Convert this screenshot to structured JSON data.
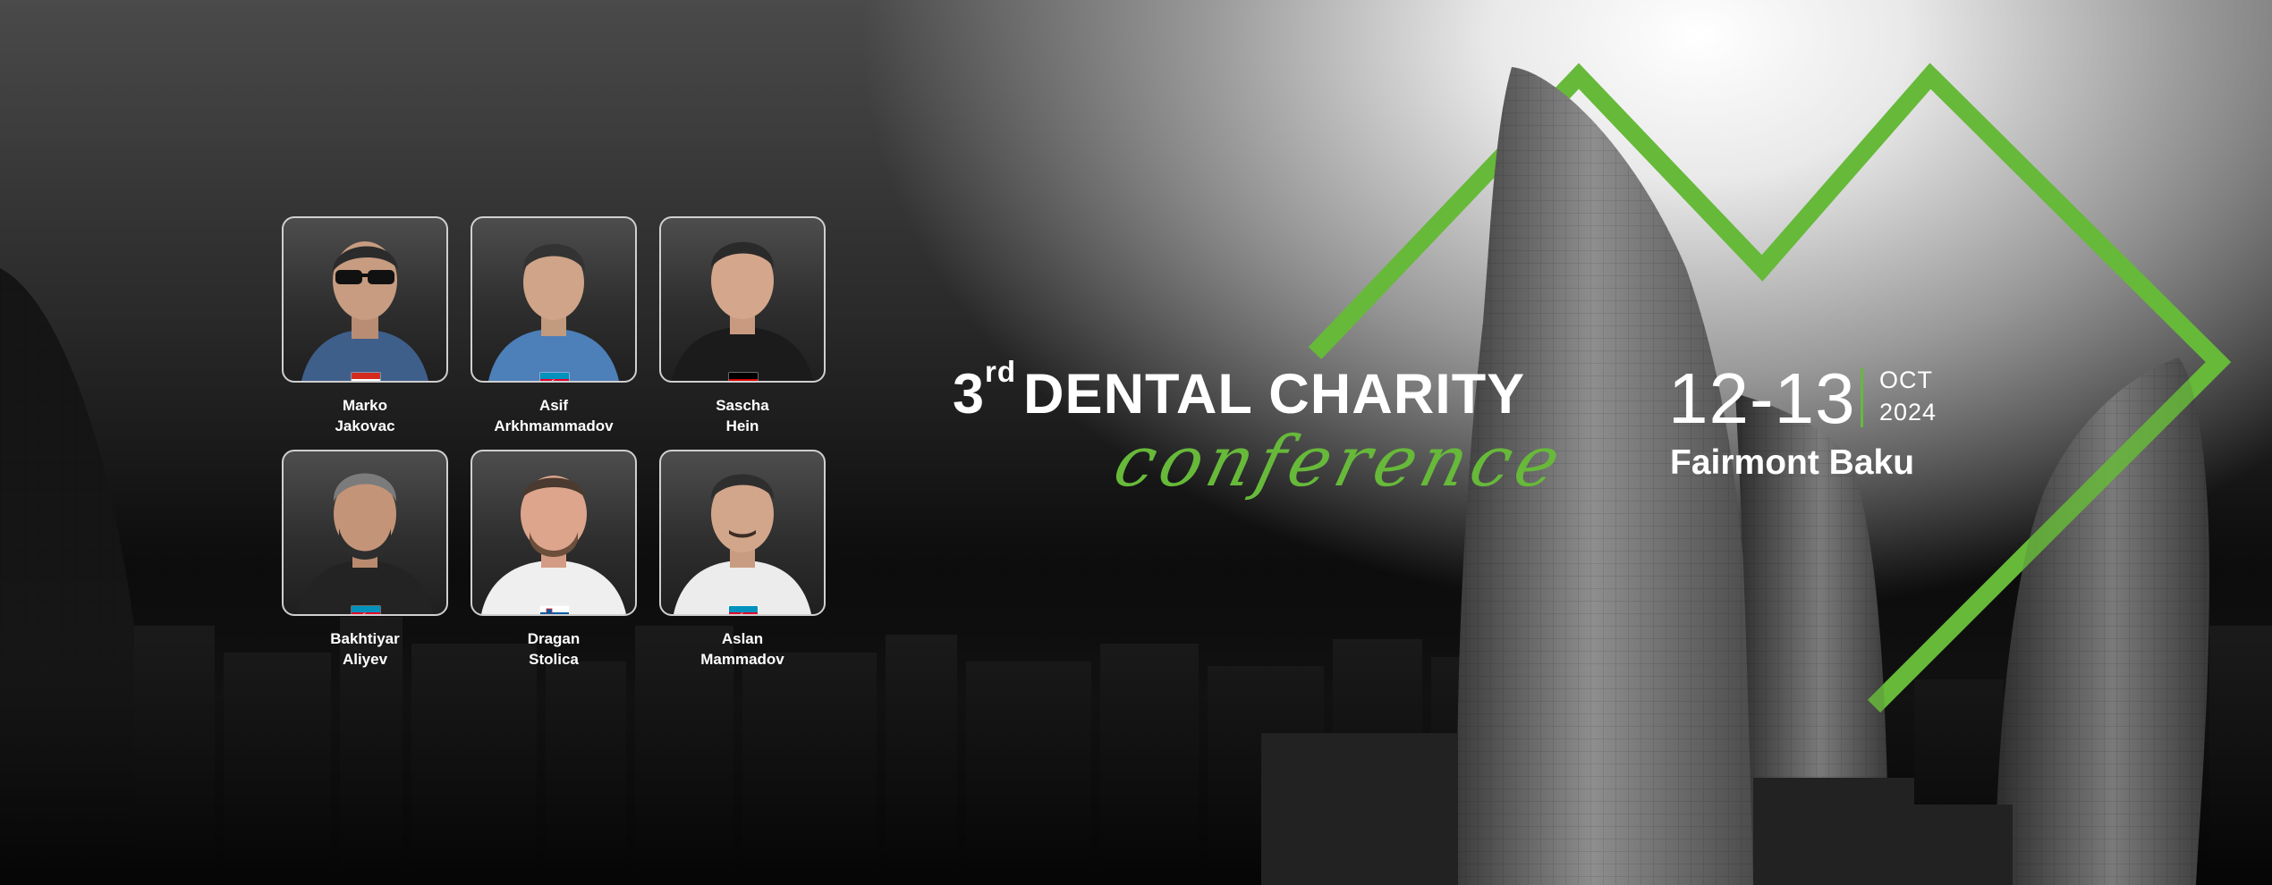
{
  "banner": {
    "title_number": "3",
    "title_suffix": "rd",
    "title_main": "DENTAL CHARITY",
    "title_script": "conference",
    "date_range": "12-13",
    "date_month": "OCT",
    "date_year": "2024",
    "venue": "Fairmont Baku",
    "accent_color": "#67b93a"
  },
  "speakers": [
    {
      "first": "Marko",
      "last": "Jakovac",
      "flag": "croatia-flag-icon"
    },
    {
      "first": "Asif",
      "last": "Arkhmammadov",
      "flag": "azerbaijan-flag-icon"
    },
    {
      "first": "Sascha",
      "last": "Hein",
      "flag": "germany-flag-icon"
    },
    {
      "first": "Bakhtiyar",
      "last": "Aliyev",
      "flag": "azerbaijan-flag-icon"
    },
    {
      "first": "Dragan",
      "last": "Stolica",
      "flag": "slovenia-flag-icon"
    },
    {
      "first": "Aslan",
      "last": "Mammadov",
      "flag": "azerbaijan-flag-icon"
    }
  ]
}
